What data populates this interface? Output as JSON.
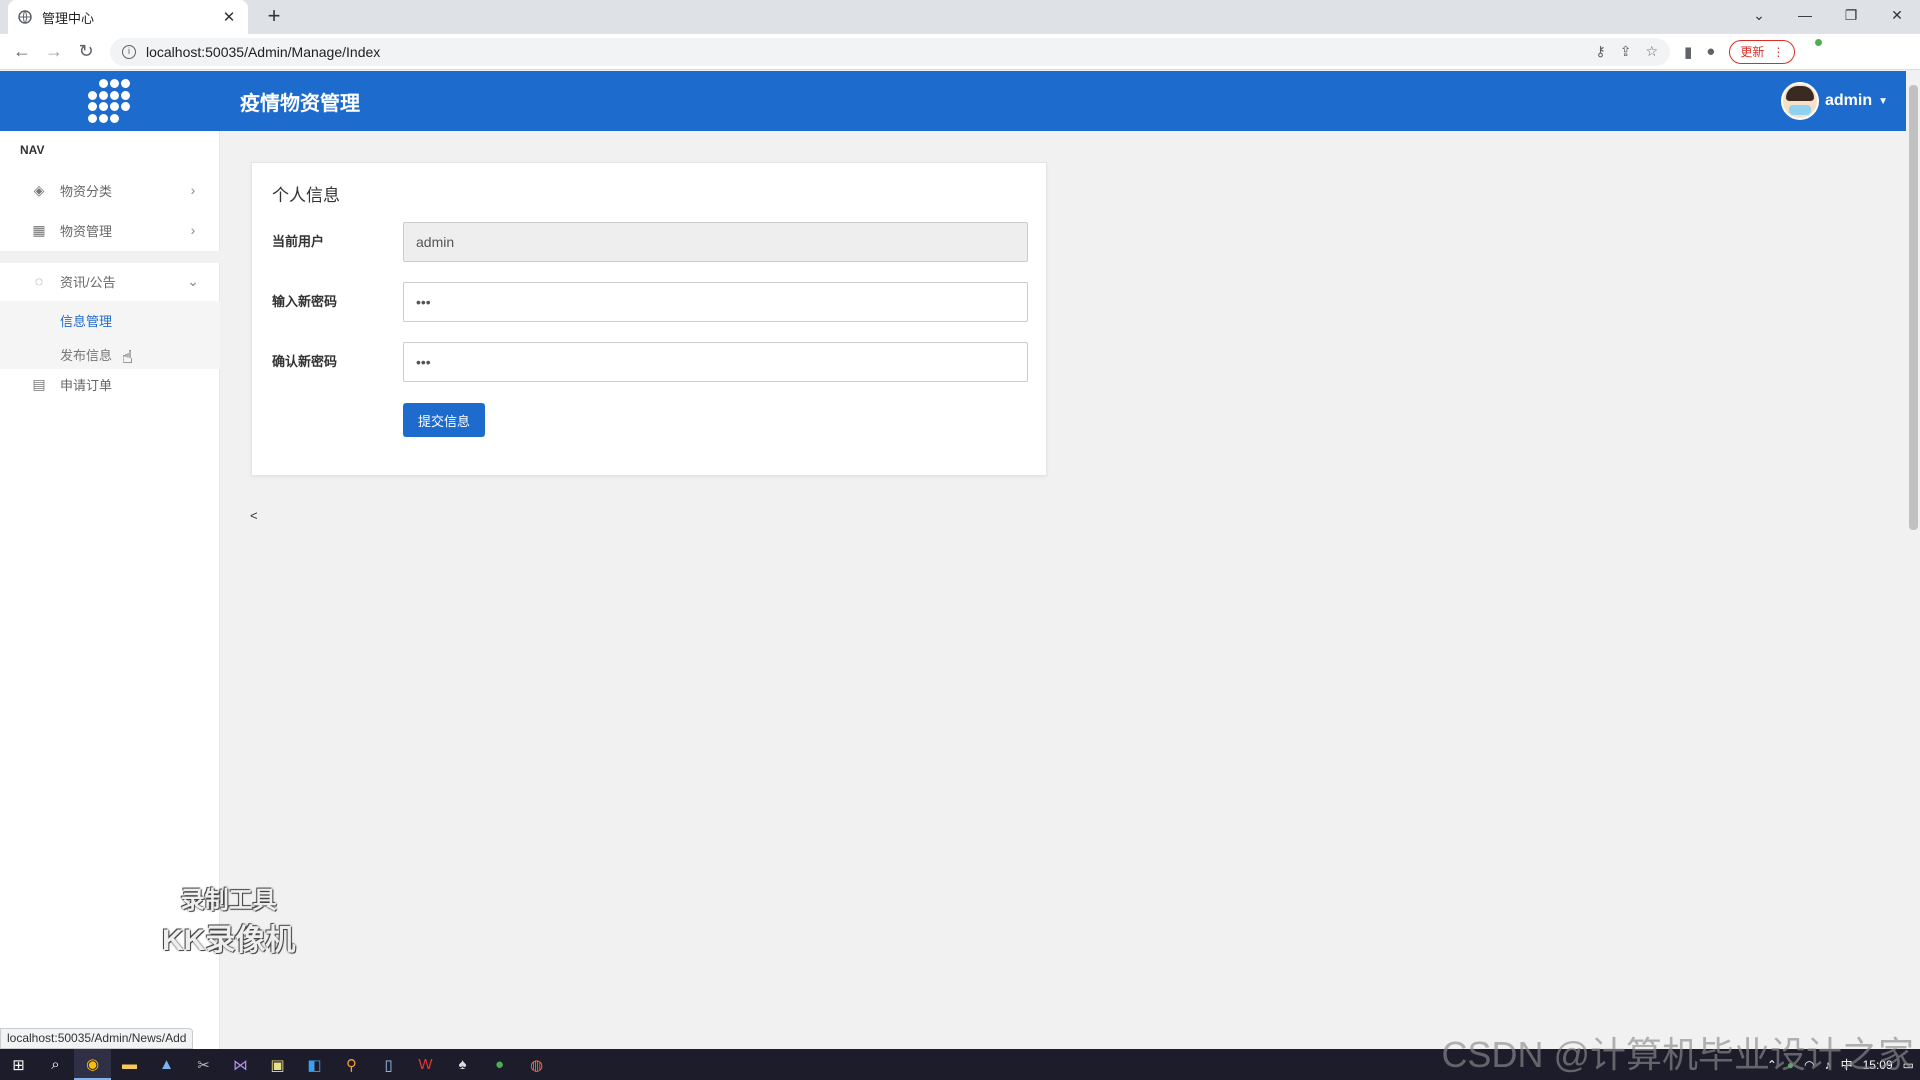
{
  "browser": {
    "tab_title": "管理中心",
    "url": "localhost:50035/Admin/Manage/Index",
    "update_label": "更新",
    "status_url": "localhost:50035/Admin/News/Add"
  },
  "header": {
    "title": "疫情物资管理",
    "user": "admin"
  },
  "sidebar": {
    "nav_heading": "NAV",
    "items": [
      {
        "label": "物资分类",
        "icon": "tag-icon"
      },
      {
        "label": "物资管理",
        "icon": "grid-icon"
      },
      {
        "label": "资讯/公告",
        "icon": "chat-icon"
      },
      {
        "label": "申请订单",
        "icon": "id-card-icon"
      }
    ],
    "sub_items": [
      {
        "label": "信息管理"
      },
      {
        "label": "发布信息"
      }
    ]
  },
  "form": {
    "title": "个人信息",
    "current_user_label": "当前用户",
    "current_user_value": "admin",
    "new_password_label": "输入新密码",
    "new_password_value": "•••",
    "confirm_password_label": "确认新密码",
    "confirm_password_value": "•••",
    "submit_label": "提交信息"
  },
  "misc": {
    "lt_mark": "<"
  },
  "watermarks": {
    "kk_line1": "录制工具",
    "kk_line2": "KK录像机",
    "csdn": "CSDN @计算机毕业设计之家"
  },
  "taskbar": {
    "ime": "中",
    "time": "15:09"
  },
  "colors": {
    "brand_blue": "#1e6bce",
    "update_red": "#d93025"
  }
}
